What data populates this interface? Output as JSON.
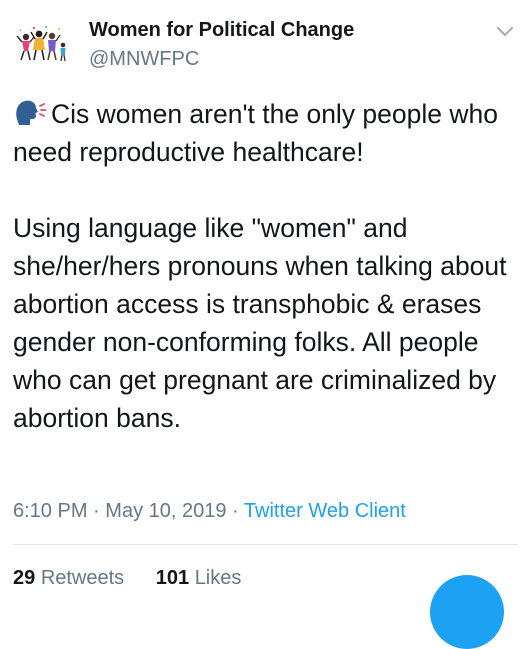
{
  "account": {
    "display_name": "Women for Political Change",
    "handle": "@MNWFPC"
  },
  "tweet": {
    "emoji_icon": "speaking-head-icon",
    "line1": "Cis women aren't the only people who need reproductive healthcare!",
    "line2": "Using language like \"women\" and she/her/hers pronouns when talking about abortion access is transphobic & erases gender non-conforming folks. All people who can get pregnant are criminalized by abortion bans."
  },
  "meta": {
    "time": "6:10 PM",
    "separator": "·",
    "date": "May 10, 2019",
    "source": "Twitter Web Client"
  },
  "stats": {
    "retweets_count": "29",
    "retweets_label": "Retweets",
    "likes_count": "101",
    "likes_label": "Likes"
  },
  "colors": {
    "link": "#1da1f2",
    "secondary_text": "#657786",
    "divider": "#e1e8ed"
  }
}
